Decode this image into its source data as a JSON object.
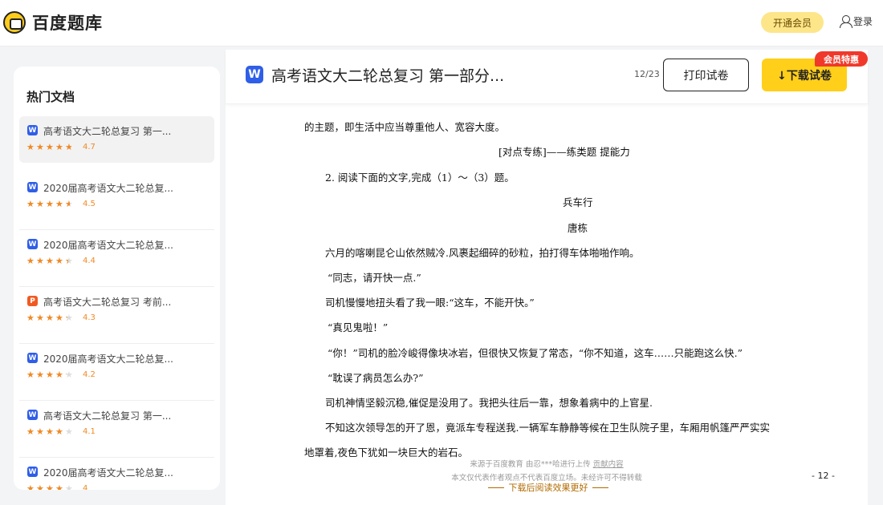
{
  "header": {
    "logo_text": "百度题库",
    "vip_label": "开通会员",
    "login_label": "登录"
  },
  "sidebar": {
    "title": "热门文档",
    "items": [
      {
        "type": "W",
        "name": "高考语文大二轮总复习 第一...",
        "rating": 4.7,
        "rating_text": "4.7"
      },
      {
        "type": "W",
        "name": "2020届高考语文大二轮总复...",
        "rating": 4.5,
        "rating_text": "4.5"
      },
      {
        "type": "W",
        "name": "2020届高考语文大二轮总复...",
        "rating": 4.4,
        "rating_text": "4.4"
      },
      {
        "type": "P",
        "name": "高考语文大二轮总复习 考前...",
        "rating": 4.3,
        "rating_text": "4.3"
      },
      {
        "type": "W",
        "name": "2020届高考语文大二轮总复...",
        "rating": 4.2,
        "rating_text": "4.2"
      },
      {
        "type": "W",
        "name": "高考语文大二轮总复习 第一...",
        "rating": 4.1,
        "rating_text": "4.1"
      },
      {
        "type": "W",
        "name": "2020届高考语文大二轮总复...",
        "rating": 4.0,
        "rating_text": "4"
      }
    ]
  },
  "document": {
    "icon": "W",
    "title": "高考语文大二轮总复习 第一部分...",
    "page_count": "12/23",
    "print_label": "打印试卷",
    "download_label": "↓下载试卷",
    "vip_badge": "会员特惠",
    "lines": [
      "的主题，即生活中应当尊重他人、宽容大度。",
      "[对点专练]——练类题  提能力",
      "2. 阅读下面的文字,完成（1）～（3）题。",
      "兵车行",
      "唐栋",
      "六月的喀喇昆仑山依然贼冷.风裹起细碎的砂粒，拍打得车体啪啪作响。",
      "“同志，请开快一点.”",
      "司机慢慢地扭头看了我一眼:“这车，不能开快。”",
      "“真见鬼啦！”",
      "“你！”司机的脸冷峻得像块冰岩，但很快又恢复了常态，“你不知道，这车……只能跑这么快.”",
      "“耽误了病员怎么办?”",
      "司机神情坚毅沉稳,催促是没用了。我把头往后一靠，想象着病中的上官星.",
      "不知这次领导怎的开了恩，竟派车专程送我.一辆军车静静等候在卫生队院子里，车厢用帆篷严严实实",
      "地罩着,夜色下犹如一块巨大的岩石。"
    ],
    "footer_source_prefix": "来源于百度教育 由",
    "footer_source_user": "忍***哈",
    "footer_source_mid": "进行上传",
    "footer_source_link": "贡献内容",
    "footer_disclaimer": "本文仅代表作者观点不代表百度立场。未经许可不得转载",
    "read_more": "下载后阅读效果更好",
    "page_number": "- 12 -"
  },
  "colors": {
    "accent_yellow": "#ffcf1a",
    "badge_red": "#f0392b",
    "star_orange": "#f08a24",
    "word_blue": "#2f5ee8",
    "ppt_orange": "#f05a22"
  }
}
